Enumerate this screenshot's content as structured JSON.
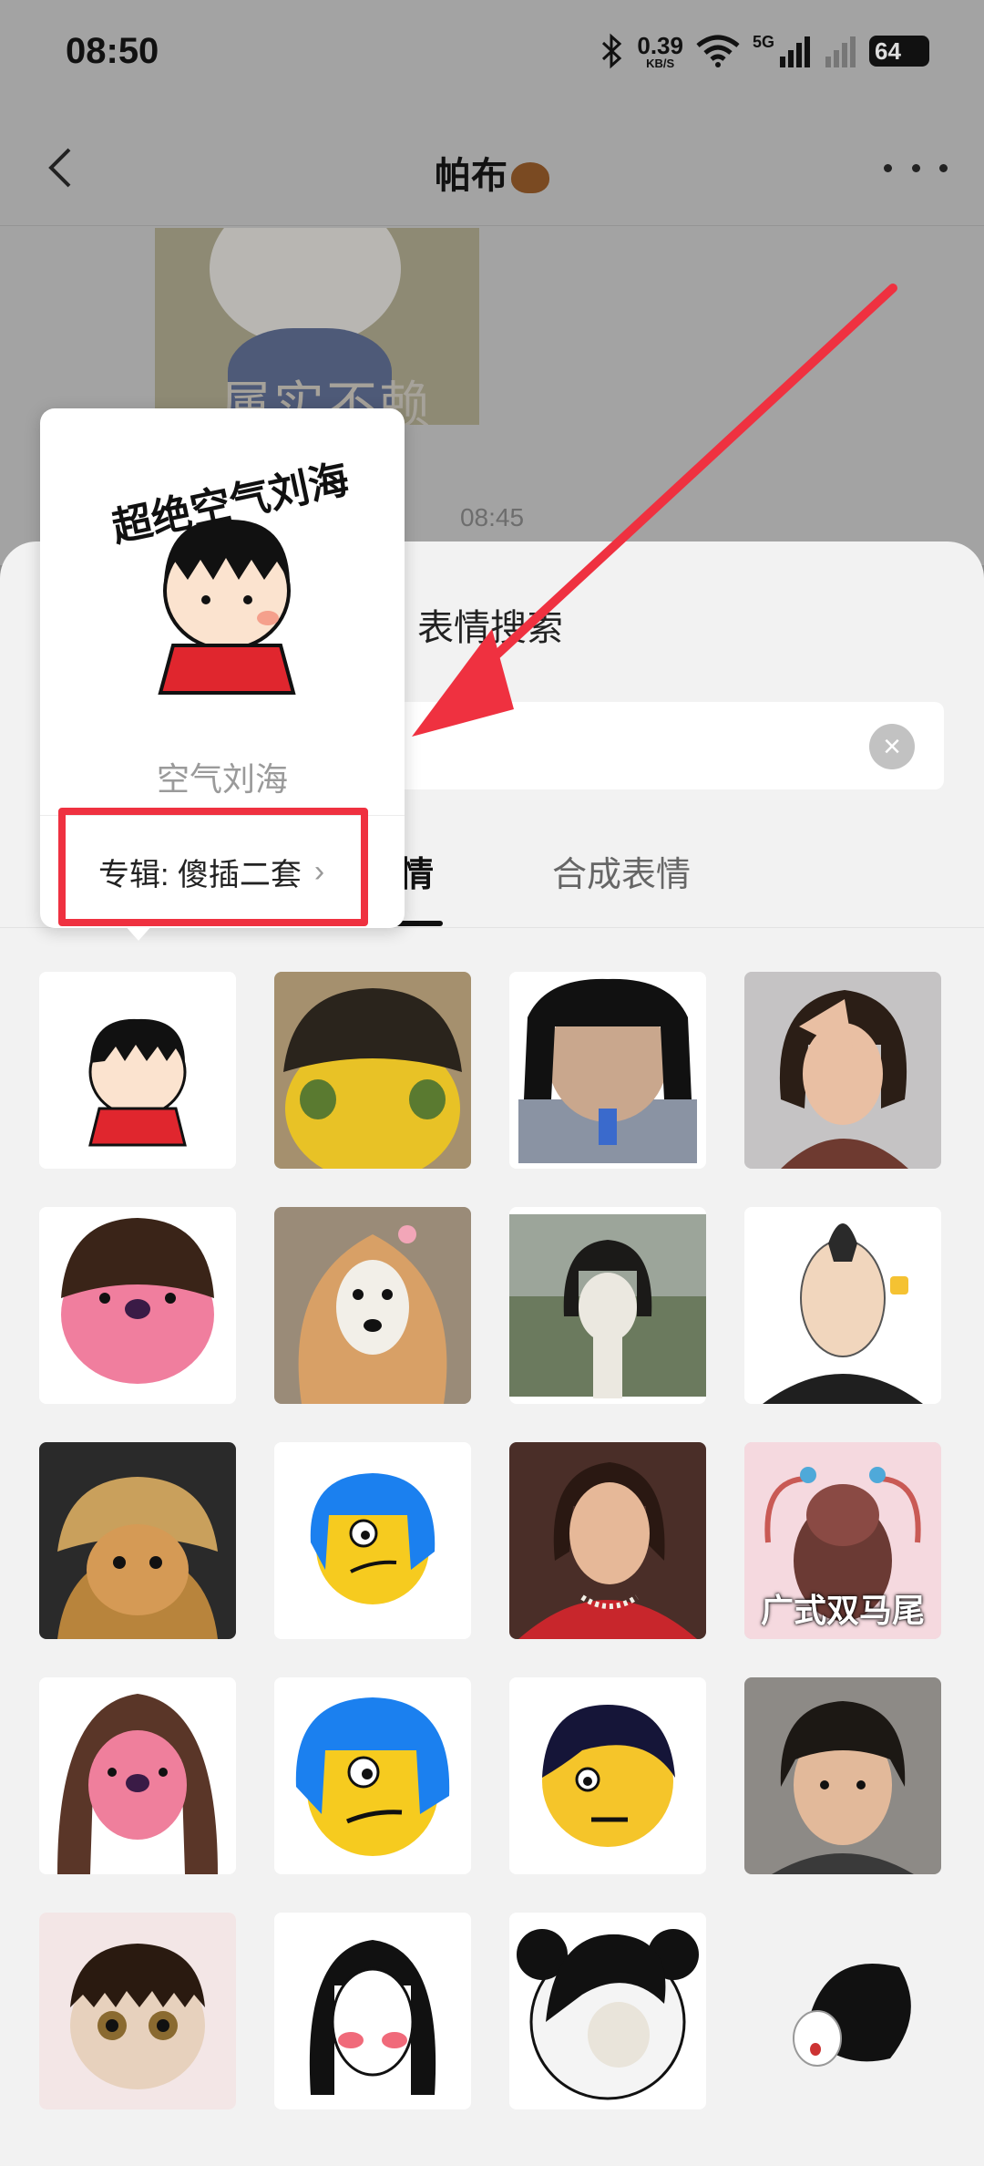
{
  "status_bar": {
    "time": "08:50",
    "net_speed_value": "0.39",
    "net_speed_unit": "KB/S",
    "network_tag": "5G",
    "battery": "64"
  },
  "nav": {
    "title": "帕布",
    "title_emoji": "bear-face-emoji"
  },
  "chat": {
    "sticker_caption": "属实不赖",
    "timestamp": "08:45"
  },
  "sheet": {
    "title": "表情搜索",
    "tabs": [
      {
        "label": "表情",
        "active": true
      },
      {
        "label": "合成表情",
        "active": false
      }
    ]
  },
  "preview": {
    "sticker_text": "超绝空气刘海",
    "name": "空气刘海",
    "album_link": "专辑: 傻插二套"
  },
  "stickers": [
    {
      "icon": "air-bangs-girl-sticker"
    },
    {
      "icon": "mushroom-hair-mango-sticker"
    },
    {
      "icon": "bowl-cut-figure-sticker"
    },
    {
      "icon": "bob-hair-woman-sticker"
    },
    {
      "icon": "pink-beaver-bangs-sticker"
    },
    {
      "icon": "long-hair-dog-sticker"
    },
    {
      "icon": "bob-hair-cat-sticker"
    },
    {
      "icon": "mohawk-man-sticker"
    },
    {
      "icon": "wig-cat-sticker"
    },
    {
      "icon": "blue-hair-emoji-sticker"
    },
    {
      "icon": "red-dress-woman-sticker"
    },
    {
      "icon": "twin-tail-cockroach-sticker",
      "label": "广式双马尾"
    },
    {
      "icon": "brown-hair-beaver-sticker"
    },
    {
      "icon": "blue-hair-emoji-large-sticker"
    },
    {
      "icon": "emo-hair-emoji-sticker"
    },
    {
      "icon": "bowl-cut-man-sticker"
    },
    {
      "icon": "bangs-kitten-sticker"
    },
    {
      "icon": "blushing-girl-sketch-sticker"
    },
    {
      "icon": "panda-long-hair-sticker"
    },
    {
      "icon": "black-fan-hair-sticker"
    }
  ],
  "colors": {
    "highlight": "#ef3140",
    "sheet_bg": "#f2f2f2"
  }
}
